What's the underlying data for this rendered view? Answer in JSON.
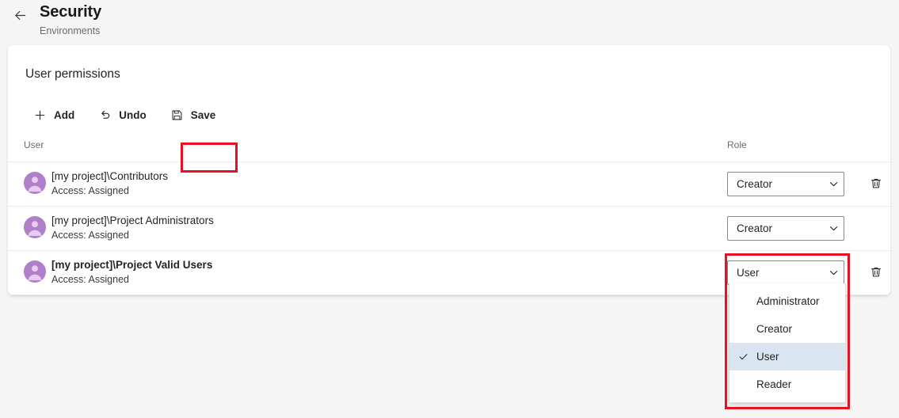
{
  "header": {
    "back_icon": "arrow-left-icon",
    "title": "Security",
    "subtitle": "Environments"
  },
  "card": {
    "title": "User permissions"
  },
  "toolbar": {
    "buttons": [
      {
        "label": "Add",
        "icon": "plus-icon"
      },
      {
        "label": "Undo",
        "icon": "undo-icon"
      },
      {
        "label": "Save",
        "icon": "save-floppy-icon"
      }
    ]
  },
  "table": {
    "columns": {
      "user": "User",
      "role": "Role"
    },
    "rows": [
      {
        "avatar": "group-avatar-icon",
        "name": "[my project]\\Contributors",
        "access": "Access: Assigned",
        "role": "Creator",
        "has_delete": true,
        "emphasized": false
      },
      {
        "avatar": "group-avatar-icon",
        "name": "[my project]\\Project Administrators",
        "access": "Access: Assigned",
        "role": "Creator",
        "has_delete": false,
        "emphasized": false
      },
      {
        "avatar": "group-avatar-icon",
        "name": "[my project]\\Project Valid Users",
        "access": "Access: Assigned",
        "role": "User",
        "has_delete": true,
        "emphasized": true
      }
    ]
  },
  "dropdown": {
    "open": true,
    "selected": "User",
    "options": [
      {
        "label": "Administrator",
        "checked": false
      },
      {
        "label": "Creator",
        "checked": false
      },
      {
        "label": "User",
        "checked": true
      },
      {
        "label": "Reader",
        "checked": false
      }
    ]
  },
  "annotations": {
    "highlight_color": "#e81123",
    "save_button_highlight": "Save",
    "role_dropdown_highlight": "User"
  },
  "colors": {
    "page_background": "#f5f5f5",
    "card_background": "#ffffff",
    "avatar_purple": "#b07fc7",
    "selected_option_background": "#d9e6f2",
    "annotation_red": "#e81123",
    "divider": "#edebe9"
  }
}
